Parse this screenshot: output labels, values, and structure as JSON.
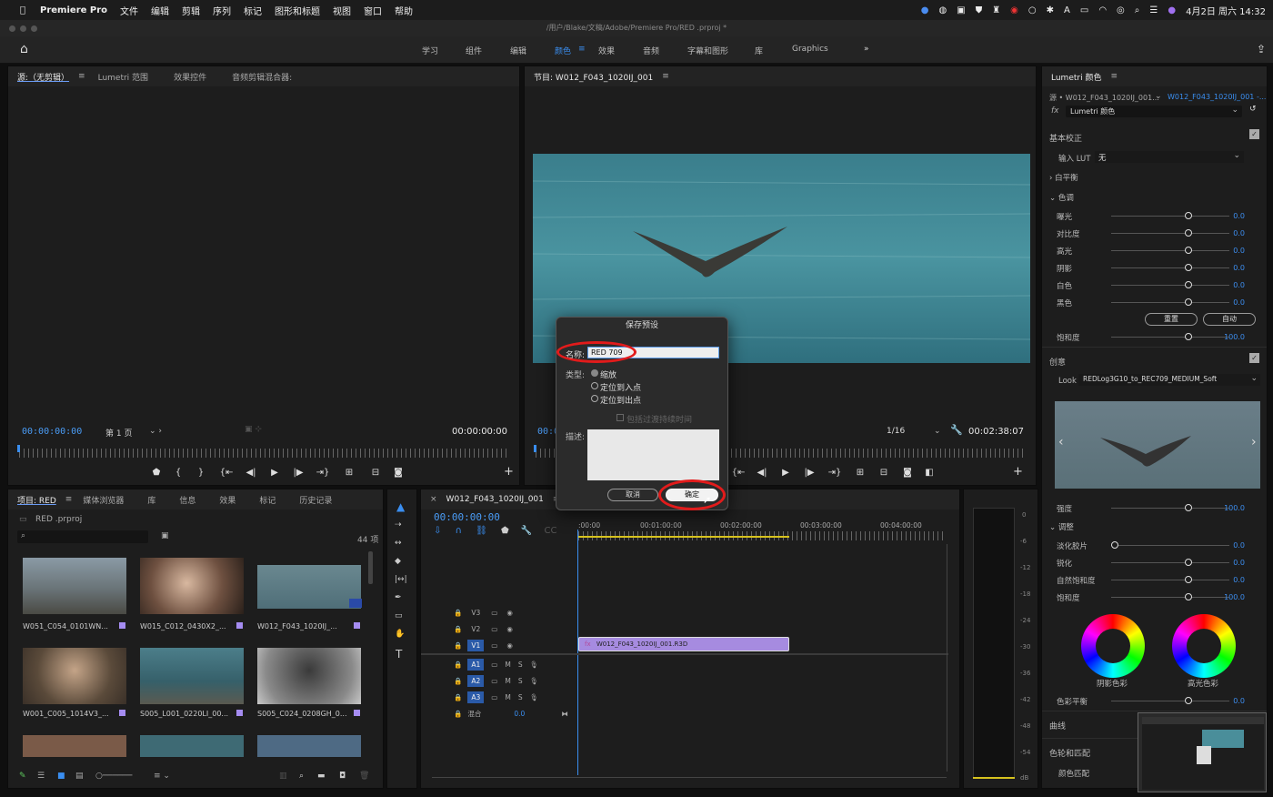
{
  "menubar": {
    "app": "Premiere Pro",
    "items": [
      "文件",
      "编辑",
      "剪辑",
      "序列",
      "标记",
      "图形和标题",
      "视图",
      "窗口",
      "帮助"
    ],
    "clock": "4月2日 周六 14:32"
  },
  "title": "/用户/Blake/文稿/Adobe/Premiere Pro/RED .prproj *",
  "workspaces": [
    "学习",
    "组件",
    "编辑",
    "颜色",
    "效果",
    "音频",
    "字幕和图形",
    "库",
    "Graphics"
  ],
  "workspace_active": "颜色",
  "source": {
    "tabs": [
      "源:（无剪辑）",
      "Lumetri 范围",
      "效果控件",
      "音频剪辑混合器:"
    ],
    "tc_left": "00:00:00:00",
    "page": "第 1 页",
    "tc_right": "00:00:00:00"
  },
  "program": {
    "title": "节目: W012_F043_1020IJ_001",
    "tc_left": "00:0",
    "zoom": "1/16",
    "tc_right": "00:02:38:07"
  },
  "dialog": {
    "title": "保存预设",
    "name_label": "名称:",
    "name_value": "RED 709",
    "type_label": "类型:",
    "options": [
      "缩放",
      "定位到入点",
      "定位到出点"
    ],
    "include_label": "包括过渡持续时间",
    "desc_label": "描述:",
    "cancel": "取消",
    "ok": "确定"
  },
  "project": {
    "tabs": [
      "项目: RED",
      "媒体浏览器",
      "库",
      "信息",
      "效果",
      "标记",
      "历史记录"
    ],
    "file": "RED .prproj",
    "count": "44 项",
    "items": [
      "W051_C054_0101WN...",
      "W015_C012_0430X2_...",
      "W012_F043_1020IJ_...",
      "W001_C005_1014V3_...",
      "S005_L001_0220LI_00...",
      "S005_C024_0208GH_0..."
    ]
  },
  "timeline": {
    "title": "W012_F043_1020IJ_001",
    "tc": "00:00:00:00",
    "ruler": [
      ":00:00",
      "00:01:00:00",
      "00:02:00:00",
      "00:03:00:00",
      "00:04:00:00"
    ],
    "video_tracks": [
      "V3",
      "V2",
      "V1"
    ],
    "audio_tracks": [
      "A1",
      "A2",
      "A3"
    ],
    "mix_label": "混合",
    "mix_value": "0.0",
    "clip": "W012_F043_1020IJ_001.R3D"
  },
  "meter": {
    "scale": [
      "0",
      "-6",
      "-12",
      "-18",
      "-24",
      "-30",
      "-36",
      "-42",
      "-48",
      "-54",
      "dB"
    ]
  },
  "lumetri": {
    "title": "Lumetri 颜色",
    "source_sel": "源 • W012_F043_1020IJ_001...",
    "seq_sel": "W012_F043_1020IJ_001 -...",
    "effect": "Lumetri 颜色",
    "basic": "基本校正",
    "lut_label": "输入 LUT",
    "lut_value": "无",
    "wb": "白平衡",
    "tone": "色调",
    "tone_rows": [
      {
        "label": "曝光",
        "value": "0.0"
      },
      {
        "label": "对比度",
        "value": "0.0"
      },
      {
        "label": "高光",
        "value": "0.0"
      },
      {
        "label": "阴影",
        "value": "0.0"
      },
      {
        "label": "白色",
        "value": "0.0"
      },
      {
        "label": "黑色",
        "value": "0.0"
      }
    ],
    "reset": "重置",
    "auto": "自动",
    "sat_label": "饱和度",
    "sat_value": "100.0",
    "creative": "创意",
    "look_label": "Look",
    "look_value": "REDLog3G10_to_REC709_MEDIUM_Soft",
    "intensity_label": "强度",
    "intensity_value": "100.0",
    "adjust": "调整",
    "adjust_rows": [
      {
        "label": "淡化胶片",
        "value": "0.0"
      },
      {
        "label": "锐化",
        "value": "0.0"
      },
      {
        "label": "自然饱和度",
        "value": "0.0"
      },
      {
        "label": "饱和度",
        "value": "100.0"
      }
    ],
    "shadow_wheel": "阴影色彩",
    "highlight_wheel": "高光色彩",
    "balance_label": "色彩平衡",
    "balance_value": "0.0",
    "curves": "曲线",
    "wheels_match": "色轮和匹配",
    "color_match": "颜色匹配"
  }
}
